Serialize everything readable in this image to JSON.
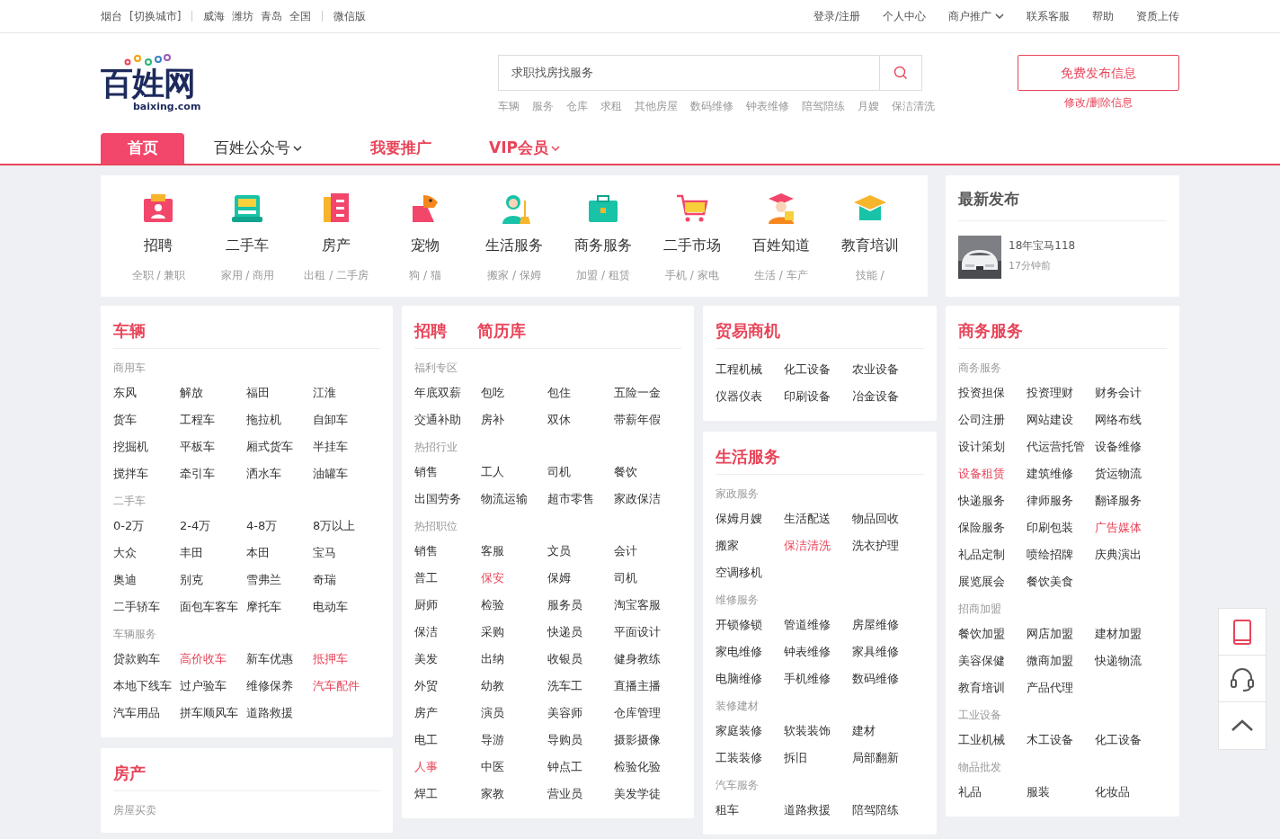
{
  "top_bar": {
    "city": "烟台",
    "switch_city": "[切换城市]",
    "nearby": [
      "威海",
      "潍坊",
      "青岛",
      "全国"
    ],
    "wechat": "微信版",
    "links": [
      {
        "label": "登录/注册",
        "dropdown": false
      },
      {
        "label": "个人中心",
        "dropdown": false
      },
      {
        "label": "商户推广",
        "dropdown": true
      },
      {
        "label": "联系客服",
        "dropdown": false
      },
      {
        "label": "帮助",
        "dropdown": false
      },
      {
        "label": "资质上传",
        "dropdown": false
      }
    ]
  },
  "header": {
    "logo": {
      "name": "百姓网",
      "domain": "baixing.com"
    },
    "search": {
      "placeholder": "求职找房找服务"
    },
    "hot_words": [
      "车辆",
      "服务",
      "仓库",
      "求租",
      "其他房屋",
      "数码维修",
      "钟表维修",
      "陪驾陪练",
      "月嫂",
      "保洁清洗"
    ],
    "post_button": "免费发布信息",
    "edit_link": "修改/删除信息"
  },
  "nav": [
    {
      "label": "首页",
      "selected": true,
      "kind": "plain",
      "dropdown": false
    },
    {
      "label": "百姓公众号",
      "selected": false,
      "kind": "plain",
      "dropdown": true
    },
    {
      "label": "我要推广",
      "selected": false,
      "kind": "promo",
      "dropdown": false
    },
    {
      "label": "VIP会员",
      "selected": false,
      "kind": "promo",
      "dropdown": true
    }
  ],
  "categories": [
    {
      "label": "招聘",
      "sub": "全职 / 兼职"
    },
    {
      "label": "二手车",
      "sub": "家用 / 商用"
    },
    {
      "label": "房产",
      "sub": "出租 / 二手房"
    },
    {
      "label": "宠物",
      "sub": "狗 / 猫"
    },
    {
      "label": "生活服务",
      "sub": "搬家 / 保姆"
    },
    {
      "label": "商务服务",
      "sub": "加盟 / 租赁"
    },
    {
      "label": "二手市场",
      "sub": "手机 / 家电"
    },
    {
      "label": "百姓知道",
      "sub": "生活 / 车产"
    },
    {
      "label": "教育培训",
      "sub": "技能 /"
    }
  ],
  "latest": {
    "title": "最新发布",
    "items": [
      {
        "title": "18年宝马118",
        "time": "17分钟前"
      }
    ]
  },
  "columns": [
    [
      {
        "titles": [
          "车辆"
        ],
        "groups": [
          {
            "heading": "商用车",
            "links": [
              {
                "label": "东风",
                "hot": false
              },
              {
                "label": "解放",
                "hot": false
              },
              {
                "label": "福田",
                "hot": false
              },
              {
                "label": "江淮",
                "hot": false
              },
              {
                "label": "货车",
                "hot": false
              },
              {
                "label": "工程车",
                "hot": false
              },
              {
                "label": "拖拉机",
                "hot": false
              },
              {
                "label": "自卸车",
                "hot": false
              },
              {
                "label": "挖掘机",
                "hot": false
              },
              {
                "label": "平板车",
                "hot": false
              },
              {
                "label": "厢式货车",
                "hot": false
              },
              {
                "label": "半挂车",
                "hot": false
              },
              {
                "label": "搅拌车",
                "hot": false
              },
              {
                "label": "牵引车",
                "hot": false
              },
              {
                "label": "洒水车",
                "hot": false
              },
              {
                "label": "油罐车",
                "hot": false
              }
            ]
          },
          {
            "heading": "二手车",
            "links": [
              {
                "label": "0-2万",
                "hot": false
              },
              {
                "label": "2-4万",
                "hot": false
              },
              {
                "label": "4-8万",
                "hot": false
              },
              {
                "label": "8万以上",
                "hot": false
              },
              {
                "label": "大众",
                "hot": false
              },
              {
                "label": "丰田",
                "hot": false
              },
              {
                "label": "本田",
                "hot": false
              },
              {
                "label": "宝马",
                "hot": false
              },
              {
                "label": "奥迪",
                "hot": false
              },
              {
                "label": "别克",
                "hot": false
              },
              {
                "label": "雪弗兰",
                "hot": false
              },
              {
                "label": "奇瑞",
                "hot": false
              },
              {
                "label": "二手轿车",
                "hot": false
              },
              {
                "label": "面包车客车",
                "hot": false
              },
              {
                "label": "摩托车",
                "hot": false
              },
              {
                "label": "电动车",
                "hot": false
              }
            ]
          },
          {
            "heading": "车辆服务",
            "links": [
              {
                "label": "贷款购车",
                "hot": false
              },
              {
                "label": "高价收车",
                "hot": true
              },
              {
                "label": "新车优惠",
                "hot": false
              },
              {
                "label": "抵押车",
                "hot": true
              },
              {
                "label": "本地下线车",
                "hot": false
              },
              {
                "label": "过户验车",
                "hot": false
              },
              {
                "label": "维修保养",
                "hot": false
              },
              {
                "label": "汽车配件",
                "hot": true
              },
              {
                "label": "汽车用品",
                "hot": false
              },
              {
                "label": "拼车顺风车",
                "hot": false
              },
              {
                "label": "道路救援",
                "hot": false
              }
            ]
          }
        ]
      },
      {
        "titles": [
          "房产"
        ],
        "groups": [
          {
            "heading": "房屋买卖"
          }
        ]
      }
    ],
    [
      {
        "titles": [
          "招聘",
          "简历库"
        ],
        "groups": [
          {
            "heading": "福利专区",
            "links": [
              {
                "label": "年底双薪",
                "hot": false
              },
              {
                "label": "包吃",
                "hot": false
              },
              {
                "label": "包住",
                "hot": false
              },
              {
                "label": "五险一金",
                "hot": false
              },
              {
                "label": "交通补助",
                "hot": false
              },
              {
                "label": "房补",
                "hot": false
              },
              {
                "label": "双休",
                "hot": false
              },
              {
                "label": "带薪年假",
                "hot": false
              }
            ]
          },
          {
            "heading": "热招行业",
            "links": [
              {
                "label": "销售",
                "hot": false
              },
              {
                "label": "工人",
                "hot": false
              },
              {
                "label": "司机",
                "hot": false
              },
              {
                "label": "餐饮",
                "hot": false
              },
              {
                "label": "出国劳务",
                "hot": false
              },
              {
                "label": "物流运输",
                "hot": false
              },
              {
                "label": "超市零售",
                "hot": false
              },
              {
                "label": "家政保洁",
                "hot": false
              }
            ]
          },
          {
            "heading": "热招职位",
            "links": [
              {
                "label": "销售",
                "hot": false
              },
              {
                "label": "客服",
                "hot": false
              },
              {
                "label": "文员",
                "hot": false
              },
              {
                "label": "会计",
                "hot": false
              },
              {
                "label": "普工",
                "hot": false
              },
              {
                "label": "保安",
                "hot": true
              },
              {
                "label": "保姆",
                "hot": false
              },
              {
                "label": "司机",
                "hot": false
              },
              {
                "label": "厨师",
                "hot": false
              },
              {
                "label": "检验",
                "hot": false
              },
              {
                "label": "服务员",
                "hot": false
              },
              {
                "label": "淘宝客服",
                "hot": false
              },
              {
                "label": "保洁",
                "hot": false
              },
              {
                "label": "采购",
                "hot": false
              },
              {
                "label": "快递员",
                "hot": false
              },
              {
                "label": "平面设计",
                "hot": false
              },
              {
                "label": "美发",
                "hot": false
              },
              {
                "label": "出纳",
                "hot": false
              },
              {
                "label": "收银员",
                "hot": false
              },
              {
                "label": "健身教练",
                "hot": false
              },
              {
                "label": "外贸",
                "hot": false
              },
              {
                "label": "幼教",
                "hot": false
              },
              {
                "label": "洗车工",
                "hot": false
              },
              {
                "label": "直播主播",
                "hot": false
              },
              {
                "label": "房产",
                "hot": false
              },
              {
                "label": "演员",
                "hot": false
              },
              {
                "label": "美容师",
                "hot": false
              },
              {
                "label": "仓库管理",
                "hot": false
              },
              {
                "label": "电工",
                "hot": false
              },
              {
                "label": "导游",
                "hot": false
              },
              {
                "label": "导购员",
                "hot": false
              },
              {
                "label": "摄影摄像",
                "hot": false
              },
              {
                "label": "人事",
                "hot": true
              },
              {
                "label": "中医",
                "hot": false
              },
              {
                "label": "钟点工",
                "hot": false
              },
              {
                "label": "检验化验",
                "hot": false
              },
              {
                "label": "焊工",
                "hot": false
              },
              {
                "label": "家教",
                "hot": false
              },
              {
                "label": "营业员",
                "hot": false
              },
              {
                "label": "美发学徒",
                "hot": false
              }
            ]
          }
        ]
      }
    ],
    [
      {
        "titles": [
          "贸易商机"
        ],
        "groups": [
          {
            "links": [
              {
                "label": "工程机械",
                "hot": false
              },
              {
                "label": "化工设备",
                "hot": false
              },
              {
                "label": "农业设备",
                "hot": false
              },
              {
                "label": "仪器仪表",
                "hot": false
              },
              {
                "label": "印刷设备",
                "hot": false
              },
              {
                "label": "冶金设备",
                "hot": false
              }
            ]
          }
        ]
      },
      {
        "titles": [
          "生活服务"
        ],
        "groups": [
          {
            "heading": "家政服务",
            "links": [
              {
                "label": "保姆月嫂",
                "hot": false
              },
              {
                "label": "生活配送",
                "hot": false
              },
              {
                "label": "物品回收",
                "hot": false
              },
              {
                "label": "搬家",
                "hot": false
              },
              {
                "label": "保洁清洗",
                "hot": true
              },
              {
                "label": "洗衣护理",
                "hot": false
              },
              {
                "label": "空调移机",
                "hot": false
              }
            ]
          },
          {
            "heading": "维修服务",
            "links": [
              {
                "label": "开锁修锁",
                "hot": false
              },
              {
                "label": "管道维修",
                "hot": false
              },
              {
                "label": "房屋维修",
                "hot": false
              },
              {
                "label": "家电维修",
                "hot": false
              },
              {
                "label": "钟表维修",
                "hot": false
              },
              {
                "label": "家具维修",
                "hot": false
              },
              {
                "label": "电脑维修",
                "hot": false
              },
              {
                "label": "手机维修",
                "hot": false
              },
              {
                "label": "数码维修",
                "hot": false
              }
            ]
          },
          {
            "heading": "装修建材",
            "links": [
              {
                "label": "家庭装修",
                "hot": false
              },
              {
                "label": "软装装饰",
                "hot": false
              },
              {
                "label": "建材",
                "hot": false
              },
              {
                "label": "工装装修",
                "hot": false
              },
              {
                "label": "拆旧",
                "hot": false
              },
              {
                "label": "局部翻新",
                "hot": false
              }
            ]
          },
          {
            "heading": "汽车服务",
            "links": [
              {
                "label": "租车",
                "hot": false
              },
              {
                "label": "道路救援",
                "hot": false
              },
              {
                "label": "陪驾陪练",
                "hot": false
              }
            ]
          }
        ]
      }
    ],
    [
      {
        "titles": [
          "商务服务"
        ],
        "groups": [
          {
            "heading": "商务服务",
            "links": [
              {
                "label": "投资担保",
                "hot": false
              },
              {
                "label": "投资理财",
                "hot": false
              },
              {
                "label": "财务会计",
                "hot": false
              },
              {
                "label": "公司注册",
                "hot": false
              },
              {
                "label": "网站建设",
                "hot": false
              },
              {
                "label": "网络布线",
                "hot": false
              },
              {
                "label": "设计策划",
                "hot": false
              },
              {
                "label": "代运营托管",
                "hot": false
              },
              {
                "label": "设备维修",
                "hot": false
              },
              {
                "label": "设备租赁",
                "hot": true
              },
              {
                "label": "建筑维修",
                "hot": false
              },
              {
                "label": "货运物流",
                "hot": false
              },
              {
                "label": "快递服务",
                "hot": false
              },
              {
                "label": "律师服务",
                "hot": false
              },
              {
                "label": "翻译服务",
                "hot": false
              },
              {
                "label": "保险服务",
                "hot": false
              },
              {
                "label": "印刷包装",
                "hot": false
              },
              {
                "label": "广告媒体",
                "hot": true
              },
              {
                "label": "礼品定制",
                "hot": false
              },
              {
                "label": "喷绘招牌",
                "hot": false
              },
              {
                "label": "庆典演出",
                "hot": false
              },
              {
                "label": "展览展会",
                "hot": false
              },
              {
                "label": "餐饮美食",
                "hot": false
              }
            ]
          },
          {
            "heading": "招商加盟",
            "links": [
              {
                "label": "餐饮加盟",
                "hot": false
              },
              {
                "label": "网店加盟",
                "hot": false
              },
              {
                "label": "建材加盟",
                "hot": false
              },
              {
                "label": "美容保健",
                "hot": false
              },
              {
                "label": "微商加盟",
                "hot": false
              },
              {
                "label": "快递物流",
                "hot": false
              },
              {
                "label": "教育培训",
                "hot": false
              },
              {
                "label": "产品代理",
                "hot": false
              }
            ]
          },
          {
            "heading": "工业设备",
            "links": [
              {
                "label": "工业机械",
                "hot": false
              },
              {
                "label": "木工设备",
                "hot": false
              },
              {
                "label": "化工设备",
                "hot": false
              }
            ]
          },
          {
            "heading": "物品批发",
            "links": [
              {
                "label": "礼品",
                "hot": false
              },
              {
                "label": "服装",
                "hot": false
              },
              {
                "label": "化妆品",
                "hot": false
              }
            ]
          }
        ]
      }
    ]
  ]
}
